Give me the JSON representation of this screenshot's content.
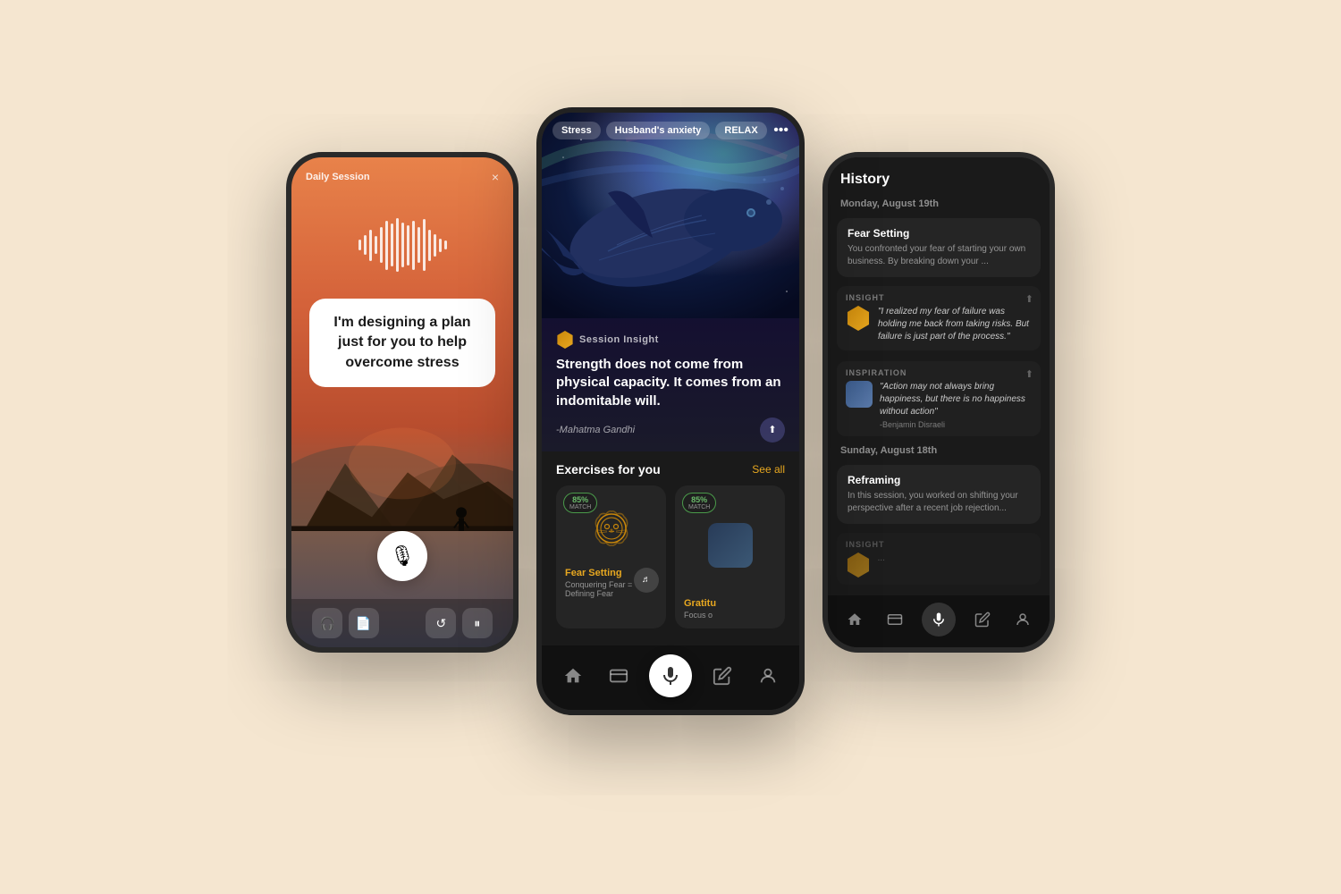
{
  "background_color": "#f5e6d0",
  "phones": {
    "left": {
      "title": "Daily Session",
      "close": "×",
      "speech_text": "I'm designing a plan just for you to help overcome stress",
      "mic_label": "microphone",
      "bottom_icons": [
        "headphones",
        "document",
        "refresh",
        "pause"
      ]
    },
    "center": {
      "tags": [
        "Stress",
        "Husband's anxiety",
        "RELAX"
      ],
      "more_icon": "•••",
      "insight_badge": "Session Insight",
      "quote": "Strength does not come from physical capacity. It comes from an indomitable will.",
      "author": "-Mahatma Gandhi",
      "exercises_title": "Exercises for you",
      "see_all": "See all",
      "exercise1": {
        "match": "85%",
        "match_label": "MATCH",
        "title": "Fear Setting",
        "subtitle": "Conquering Fear = Defining Fear"
      },
      "exercise2": {
        "match": "85%",
        "match_label": "MATCH",
        "title": "Gratitu",
        "subtitle": "Focus o"
      },
      "nav_icons": [
        "home",
        "cards",
        "microphone-center",
        "edit",
        "person"
      ]
    },
    "right": {
      "history_title": "History",
      "date1": "Monday, August 19th",
      "session1": {
        "title": "Fear Setting",
        "desc": "You confronted your fear of starting your own business. By breaking down your ..."
      },
      "insight1": {
        "label": "INSIGHT",
        "text": "\"I realized my fear of failure was holding me back from taking risks. But failure is just part of the process.\""
      },
      "inspiration1": {
        "label": "INSPIRATION",
        "text": "\"Action may not always bring happiness, but there is no happiness without action\"",
        "author": "-Benjamin Disraeli"
      },
      "date2": "Sunday, August 18th",
      "session2": {
        "title": "Reframing",
        "desc": "In this session, you worked on shifting your perspective after a recent job rejection..."
      },
      "insight2": {
        "label": "INSIGHT",
        "text": ""
      },
      "nav_icons": [
        "home",
        "cards",
        "microphone-center",
        "edit",
        "person"
      ]
    }
  }
}
